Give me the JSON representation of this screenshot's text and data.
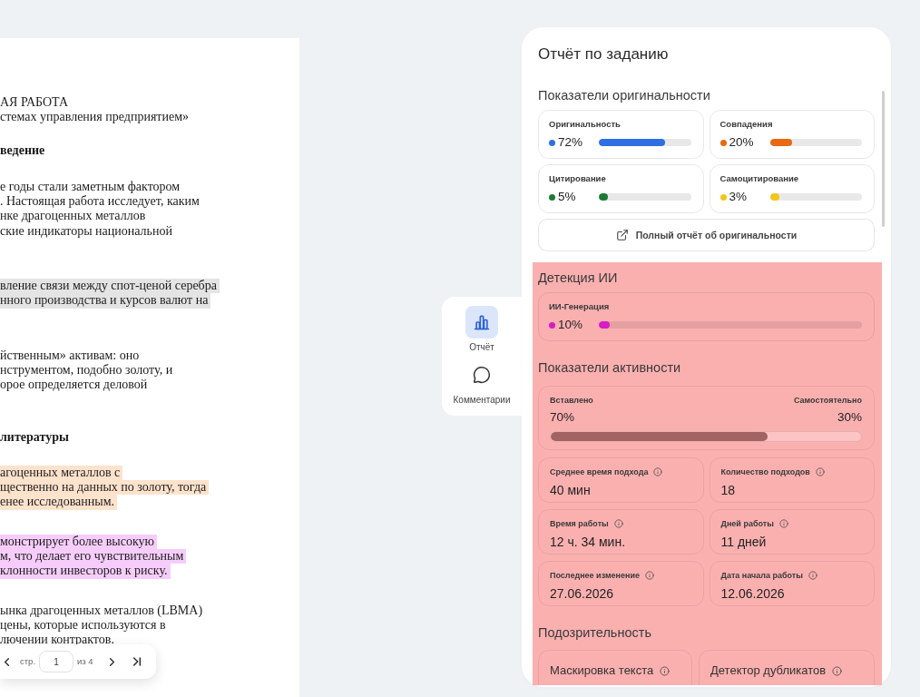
{
  "document": {
    "blocks": [
      {
        "kind": "title",
        "lines": [
          "АЯ РАБОТА",
          "стемах управления предприятием»"
        ]
      },
      {
        "kind": "heading",
        "lines": [
          "ведение"
        ]
      },
      {
        "kind": "paragraph",
        "lines": [
          "е годы стали заметным фактором",
          ". Настоящая работа исследует, каким",
          "нке драгоценных металлов",
          "ские индикаторы национальной"
        ]
      },
      {
        "kind": "paragraph",
        "color": "#e4e4e4",
        "lines": [
          "вление связи между спот-ценой серебра",
          "нного производства и курсов валют на"
        ]
      },
      {
        "kind": "paragraph",
        "lines": [
          "йственным» активам: оно",
          "нструментом, подобно золоту, и",
          "орое определяется деловой"
        ]
      },
      {
        "kind": "heading",
        "lines": [
          "литературы"
        ]
      },
      {
        "kind": "paragraph",
        "color": "#fde2cc",
        "lines": [
          "агоценных металлов с",
          "щественно на данных по золоту, тогда",
          "енее исследованным."
        ]
      },
      {
        "kind": "paragraph",
        "color": "#f6cdfa",
        "lines": [
          "монстрирует более высокую",
          "м, что делает его чувствительным",
          "клонности инвесторов к риску."
        ]
      },
      {
        "kind": "paragraph",
        "lines": [
          "ынка драгоценных металлов (LBMA)",
          "цены, которые используются в",
          "лючении контрактов."
        ]
      }
    ]
  },
  "pager": {
    "label": "стр.",
    "page": "1",
    "total": "из 4"
  },
  "sidebar": {
    "items": [
      {
        "label": "Отчёт",
        "selected": true
      },
      {
        "label": "Комментарии",
        "selected": false
      }
    ]
  },
  "report": {
    "title": "Отчёт по заданию",
    "sections": [
      {
        "kind": "metrics",
        "title": "Показатели оригинальности",
        "highlighted": false,
        "items": [
          {
            "label": "Оригинальность",
            "value": "72%",
            "color": "#2f6fe4",
            "level": 0.72
          },
          {
            "label": "Совпадения",
            "value": "20%",
            "color": "#e8690f",
            "level": 0.24
          },
          {
            "label": "Цитирование",
            "value": "5%",
            "color": "#1d7a35",
            "level": 0.1
          },
          {
            "label": "Самоцитирование",
            "value": "3%",
            "color": "#f3c51a",
            "level": 0.1
          }
        ],
        "button": {
          "label": "Полный отчёт об оригинальности"
        }
      },
      {
        "kind": "metrics",
        "title": "Детекция ИИ",
        "highlighted": true,
        "items": [
          {
            "label": "ИИ-Генерация",
            "value": "10%",
            "color": "#d91cc6",
            "level": 0.04
          }
        ]
      },
      {
        "kind": "activity",
        "title": "Показатели активности",
        "highlighted": true,
        "split": {
          "left_label": "Вставлено",
          "right_label": "Самостоятельно",
          "left_value": "70%",
          "right_value": "30%",
          "level": 0.7
        },
        "stats": [
          {
            "label": "Среднее время подхода",
            "value": "40 мин"
          },
          {
            "label": "Количество подходов",
            "value": "18"
          },
          {
            "label": "Время работы",
            "value": "12 ч. 34 мин."
          },
          {
            "label": "Дней работы",
            "value": "11 дней"
          },
          {
            "label": "Последнее изменение",
            "value": "27.06.2026"
          },
          {
            "label": "Дата начала работы",
            "value": "12.06.2026"
          }
        ]
      },
      {
        "kind": "flags",
        "title": "Подозрительность",
        "highlighted": true,
        "items": [
          {
            "label": "Маскировка текста"
          },
          {
            "label": "Детектор дубликатов"
          }
        ]
      }
    ]
  }
}
